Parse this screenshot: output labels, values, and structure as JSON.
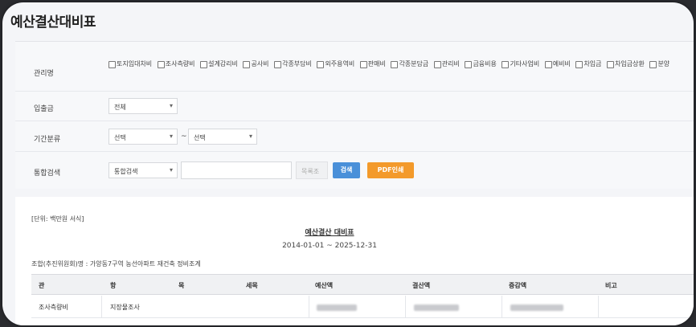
{
  "page": {
    "title": "예산결산대비표"
  },
  "filters": {
    "category": {
      "label": "관리명",
      "options": [
        "토지임대차비",
        "조사측량비",
        "설계감리비",
        "공사비",
        "각종부담비",
        "외주용역비",
        "판매비",
        "각종분담금",
        "관리비",
        "금융비용",
        "기타사업비",
        "예비비",
        "차입금",
        "차입금상환",
        "분양"
      ]
    },
    "inout": {
      "label": "입출금",
      "value": "전체"
    },
    "period": {
      "label": "기간분류",
      "from": "선택",
      "separator": "~",
      "to": "선택"
    },
    "search": {
      "label": "통합검색",
      "type_value": "통합검색",
      "keyword_label": "목록조",
      "search_button": "검색",
      "pdf_button": "PDF인쇄"
    }
  },
  "colors": {
    "search_button": "#4a90d9",
    "pdf_button": "#f39a2b"
  },
  "report": {
    "unit_note": "[단위: 백만원 서식]",
    "title": "예산결산 대비표",
    "date_range": "2014-01-01 ~ 2025-12-31",
    "project_line": "조합(추진위원회)명 : 가양동7구역 농선아파트 재건축 정비조계",
    "columns": [
      "관",
      "항",
      "목",
      "세목",
      "예산액",
      "결산액",
      "증감액",
      "비고"
    ],
    "rows": [
      {
        "gwan": "조사측량비",
        "hang": "지장물조사",
        "mok": "",
        "semok": ""
      }
    ]
  }
}
